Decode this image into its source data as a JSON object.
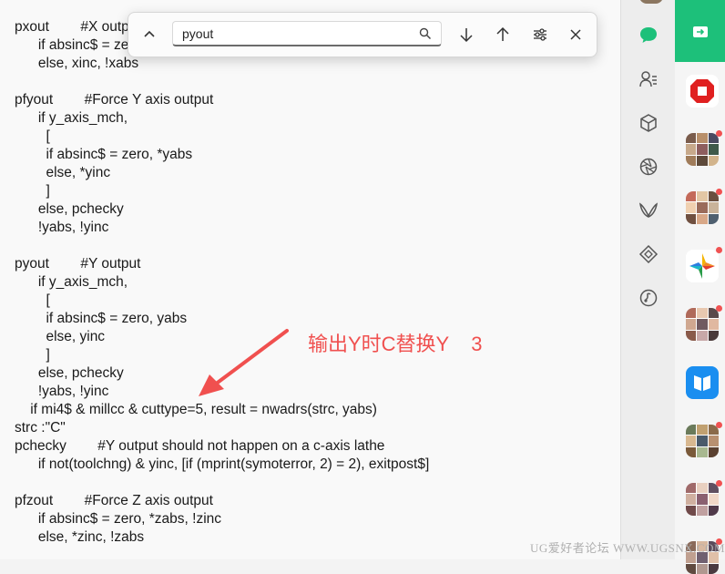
{
  "document": {
    "lines": [
      "pxout        #X output",
      "      if absinc$ = zero, *xabs, !xinc",
      "      else, xinc, !xabs",
      "pfyout        #Force Y axis output",
      "      if y_axis_mch,",
      "        [",
      "        if absinc$ = zero, *yabs",
      "        else, *yinc",
      "        ]",
      "      else, pchecky",
      "      !yabs, !yinc",
      "pyout        #Y output",
      "      if y_axis_mch,",
      "        [",
      "        if absinc$ = zero, yabs",
      "        else, yinc",
      "        ]",
      "      else, pchecky",
      "      !yabs, !yinc",
      "    if mi4$ & millcc & cuttype=5, result = nwadrs(strc, yabs)",
      "strc :\"C\"",
      "pchecky        #Y output should not happen on a c-axis lathe",
      "      if not(toolchng) & yinc, [if (mprint(symoterror, 2) = 2), exitpost$]",
      "pfzout        #Force Z axis output",
      "      if absinc$ = zero, *zabs, !zinc",
      "      else, *zinc, !zabs"
    ]
  },
  "find_bar": {
    "query": "pyout",
    "icons": [
      "chevron-up-icon",
      "search-icon",
      "arrow-down-icon",
      "arrow-up-icon",
      "filter-options-icon",
      "close-icon"
    ]
  },
  "annotation": {
    "text": "输出Y时C替换Y    3",
    "color": "#f0504f"
  },
  "watermark": {
    "text": "UG爱好者论坛 WWW.UGSNX.COM"
  },
  "sidebar": {
    "icons": [
      "chat-icon",
      "contacts-icon",
      "cube-icon",
      "aperture-icon",
      "wing-logo-icon",
      "diamond-icon",
      "music-icon"
    ],
    "accent": "#1dc07a"
  },
  "app_strip": {
    "tiles": [
      "share-app-tile",
      "red-stop-app-tile",
      "photo-group-tile-1",
      "photo-group-tile-2",
      "colorful-app-tile",
      "photo-group-tile-3",
      "blue-book-app-tile",
      "photo-group-tile-4",
      "photo-group-tile-5",
      "photo-group-tile-6"
    ]
  }
}
